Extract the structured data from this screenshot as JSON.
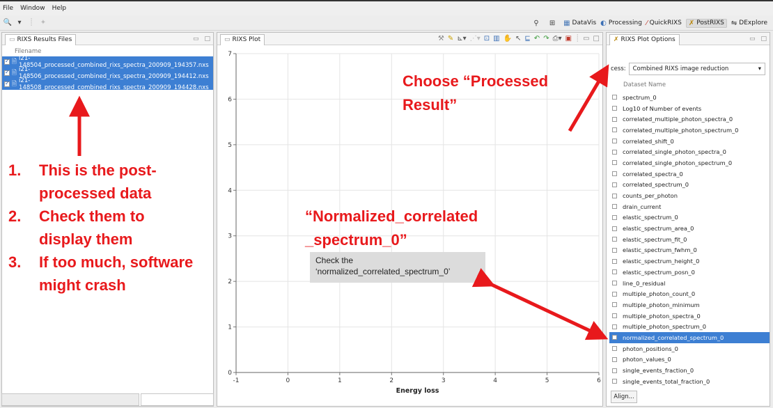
{
  "menu": [
    "File",
    "Window",
    "Help"
  ],
  "perspectives": [
    {
      "label": "DataVis",
      "icon": "datavis-icon"
    },
    {
      "label": "Processing",
      "icon": "processing-icon"
    },
    {
      "label": "QuickRIXS",
      "icon": "quickrixs-icon"
    },
    {
      "label": "PostRIXS",
      "icon": "postrixs-icon"
    },
    {
      "label": "DExplore",
      "icon": "dexplore-icon"
    }
  ],
  "left_panel": {
    "title": "RIXS Results Files",
    "column": "Filename",
    "files": [
      "i21-148504_processed_combined_rixs_spectra_200909_194357.nxs",
      "i21-148506_processed_combined_rixs_spectra_200909_194412.nxs",
      "i21-148508_processed_combined_rixs_spectra_200909_194428.nxs"
    ]
  },
  "plot_panel": {
    "title": "RIXS Plot"
  },
  "chart_data": {
    "type": "line",
    "series": [],
    "xlabel": "Energy loss",
    "ylabel": "",
    "xlim": [
      -1,
      6
    ],
    "ylim": [
      0,
      7
    ],
    "x_ticks": [
      "-1",
      "0",
      "1",
      "2",
      "3",
      "4",
      "5",
      "6"
    ],
    "y_ticks": [
      "0",
      "1",
      "2",
      "3",
      "4",
      "5",
      "6",
      "7"
    ],
    "grid": true
  },
  "options_panel": {
    "title": "RIXS Plot Options",
    "process_label": "cess:",
    "process_value": "Combined RIXS image reduction",
    "dataset_header": "Dataset Name",
    "datasets": [
      "spectrum_0",
      "Log10 of Number of events",
      "correlated_multiple_photon_spectra_0",
      "correlated_multiple_photon_spectrum_0",
      "correlated_shift_0",
      "correlated_single_photon_spectra_0",
      "correlated_single_photon_spectrum_0",
      "correlated_spectra_0",
      "correlated_spectrum_0",
      "counts_per_photon",
      "drain_current",
      "elastic_spectrum_0",
      "elastic_spectrum_area_0",
      "elastic_spectrum_fit_0",
      "elastic_spectrum_fwhm_0",
      "elastic_spectrum_height_0",
      "elastic_spectrum_posn_0",
      "line_0_residual",
      "multiple_photon_count_0",
      "multiple_photon_minimum",
      "multiple_photon_spectra_0",
      "multiple_photon_spectrum_0",
      "normalized_correlated_spectrum_0",
      "photon_positions_0",
      "photon_values_0",
      "single_events_fraction_0",
      "single_events_total_fraction_0"
    ],
    "selected_dataset": "normalized_correlated_spectrum_0",
    "align_button": "Align..."
  },
  "annotations": {
    "instructions": [
      {
        "num": "1.",
        "text": "This is the post-"
      },
      {
        "num": "",
        "text": "processed data"
      },
      {
        "num": "2.",
        "text": "Check them to"
      },
      {
        "num": "",
        "text": "display them"
      },
      {
        "num": "3.",
        "text": "If too much, software"
      },
      {
        "num": "",
        "text": "might crash"
      }
    ],
    "choose_line1": "Choose “Processed",
    "choose_line2": "Result”",
    "norm_line1": "“Normalized_correlated",
    "norm_line2": "_spectrum_0”",
    "tip_line1": "Check the",
    "tip_line2": "‘normalized_correlated_spectrum_0’",
    "color": "#e8191c"
  }
}
